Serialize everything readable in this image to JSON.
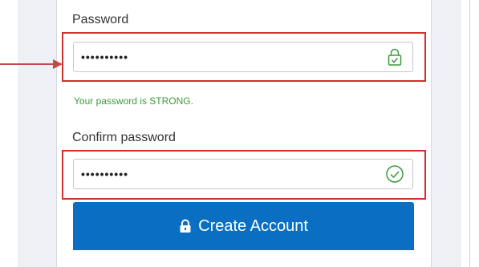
{
  "password_field": {
    "label": "Password",
    "value": "••••••••••",
    "icon": "lock-check-icon",
    "strength_message": "Your password is STRONG."
  },
  "confirm_field": {
    "label": "Confirm password",
    "value": "••••••••••",
    "icon": "check-circle-icon"
  },
  "create_button": {
    "label": "Create Account",
    "icon": "lock-icon"
  },
  "colors": {
    "highlight": "#d0312d",
    "success": "#3a9b3a",
    "primary_button": "#0a6fc2",
    "arrow": "#c44a4a"
  }
}
